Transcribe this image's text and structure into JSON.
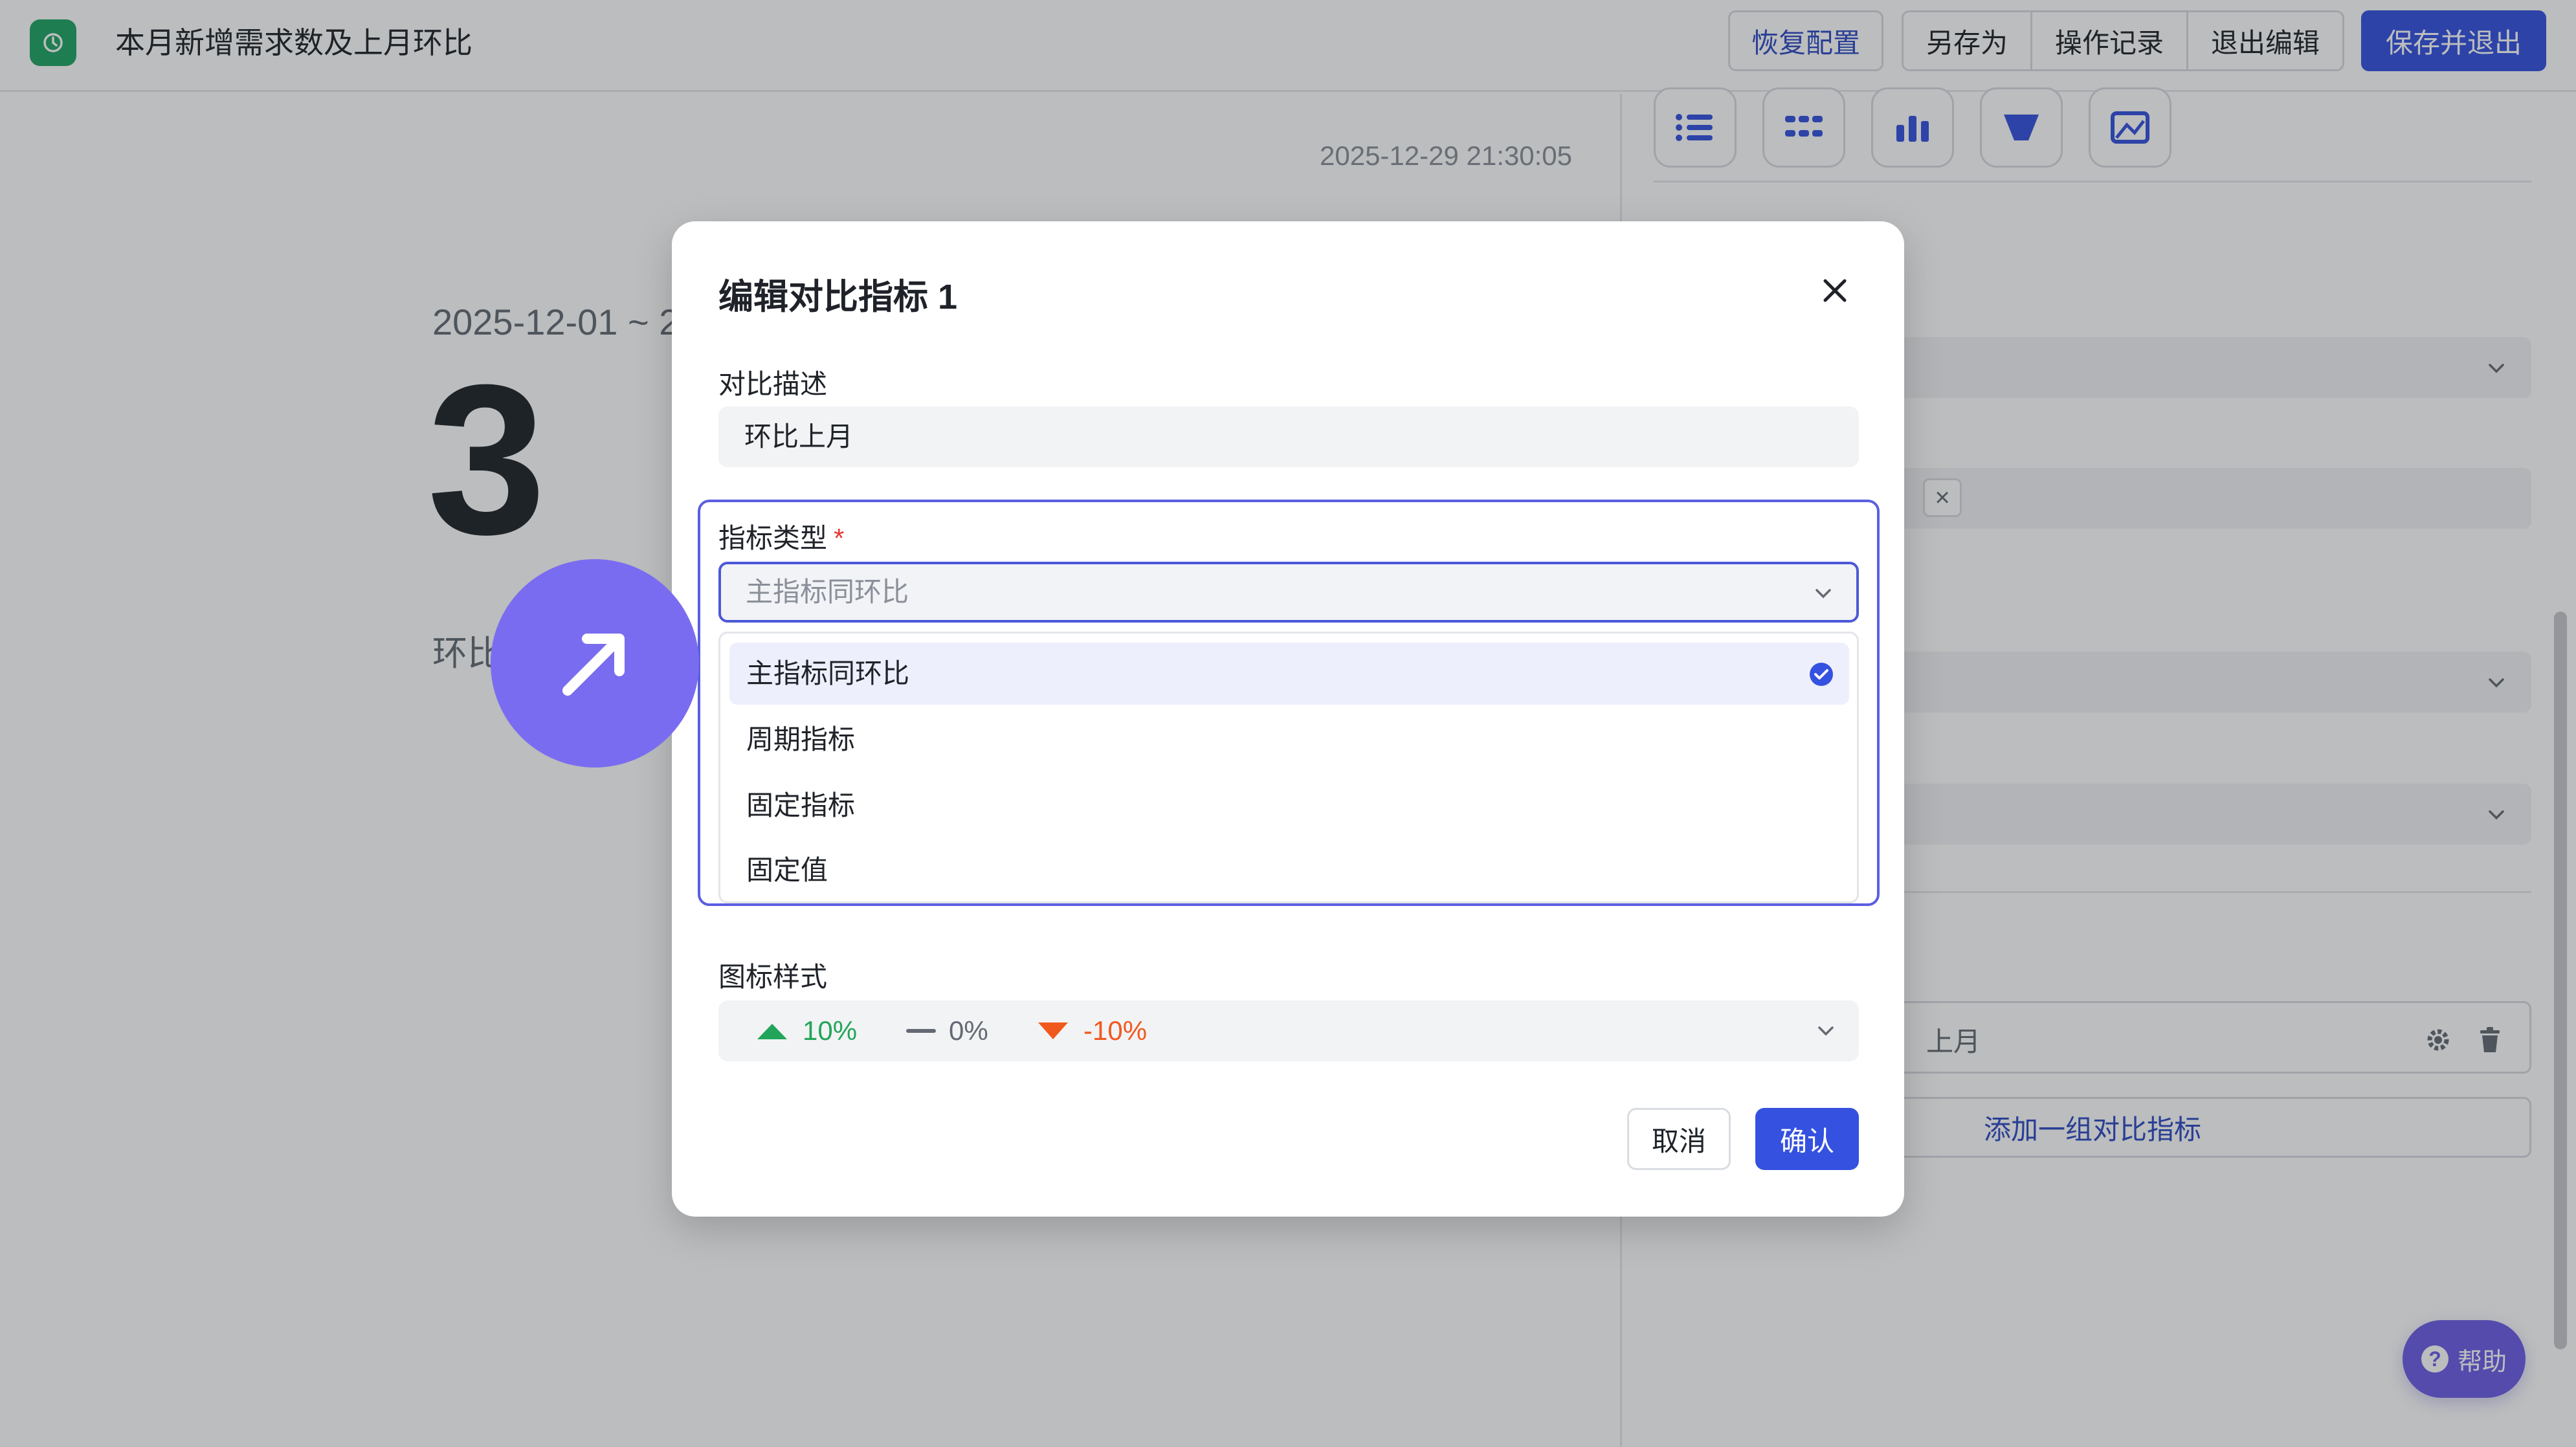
{
  "header": {
    "title": "本月新增需求数及上月环比",
    "buttons": {
      "restore": "恢复配置",
      "save_as": "另存为",
      "history": "操作记录",
      "exit_edit": "退出编辑",
      "save_exit": "保存并退出"
    }
  },
  "canvas": {
    "timestamp": "2025-12-29 21:30:05",
    "date_range": "2025-12-01 ~ 2",
    "value": "3",
    "compare_label": "环比"
  },
  "right_panel": {
    "chart_icons": [
      "list-chart-icon",
      "grid-chart-icon",
      "bar-chart-icon",
      "funnel-chart-icon",
      "image-chart-icon"
    ],
    "compare_item_text": "上月",
    "add_compare": "添加一组对比指标"
  },
  "help": {
    "label": "帮助"
  },
  "modal": {
    "title": "编辑对比指标 1",
    "desc_label": "对比描述",
    "desc_value": "环比上月",
    "type_label": "指标类型",
    "required_mark": "*",
    "type_selected": "主指标同环比",
    "options": [
      {
        "label": "主指标同环比",
        "selected": true
      },
      {
        "label": "周期指标",
        "selected": false
      },
      {
        "label": "固定指标",
        "selected": false
      },
      {
        "label": "固定值",
        "selected": false
      }
    ],
    "icon_style_label": "图标样式",
    "icon_style": {
      "up": "10%",
      "flat": "0%",
      "down": "-10%"
    },
    "cancel": "取消",
    "confirm": "确认"
  },
  "colors": {
    "primary": "#3451e0",
    "up": "#22a55a",
    "down": "#f0591e",
    "cursor": "#7a6cf0"
  }
}
